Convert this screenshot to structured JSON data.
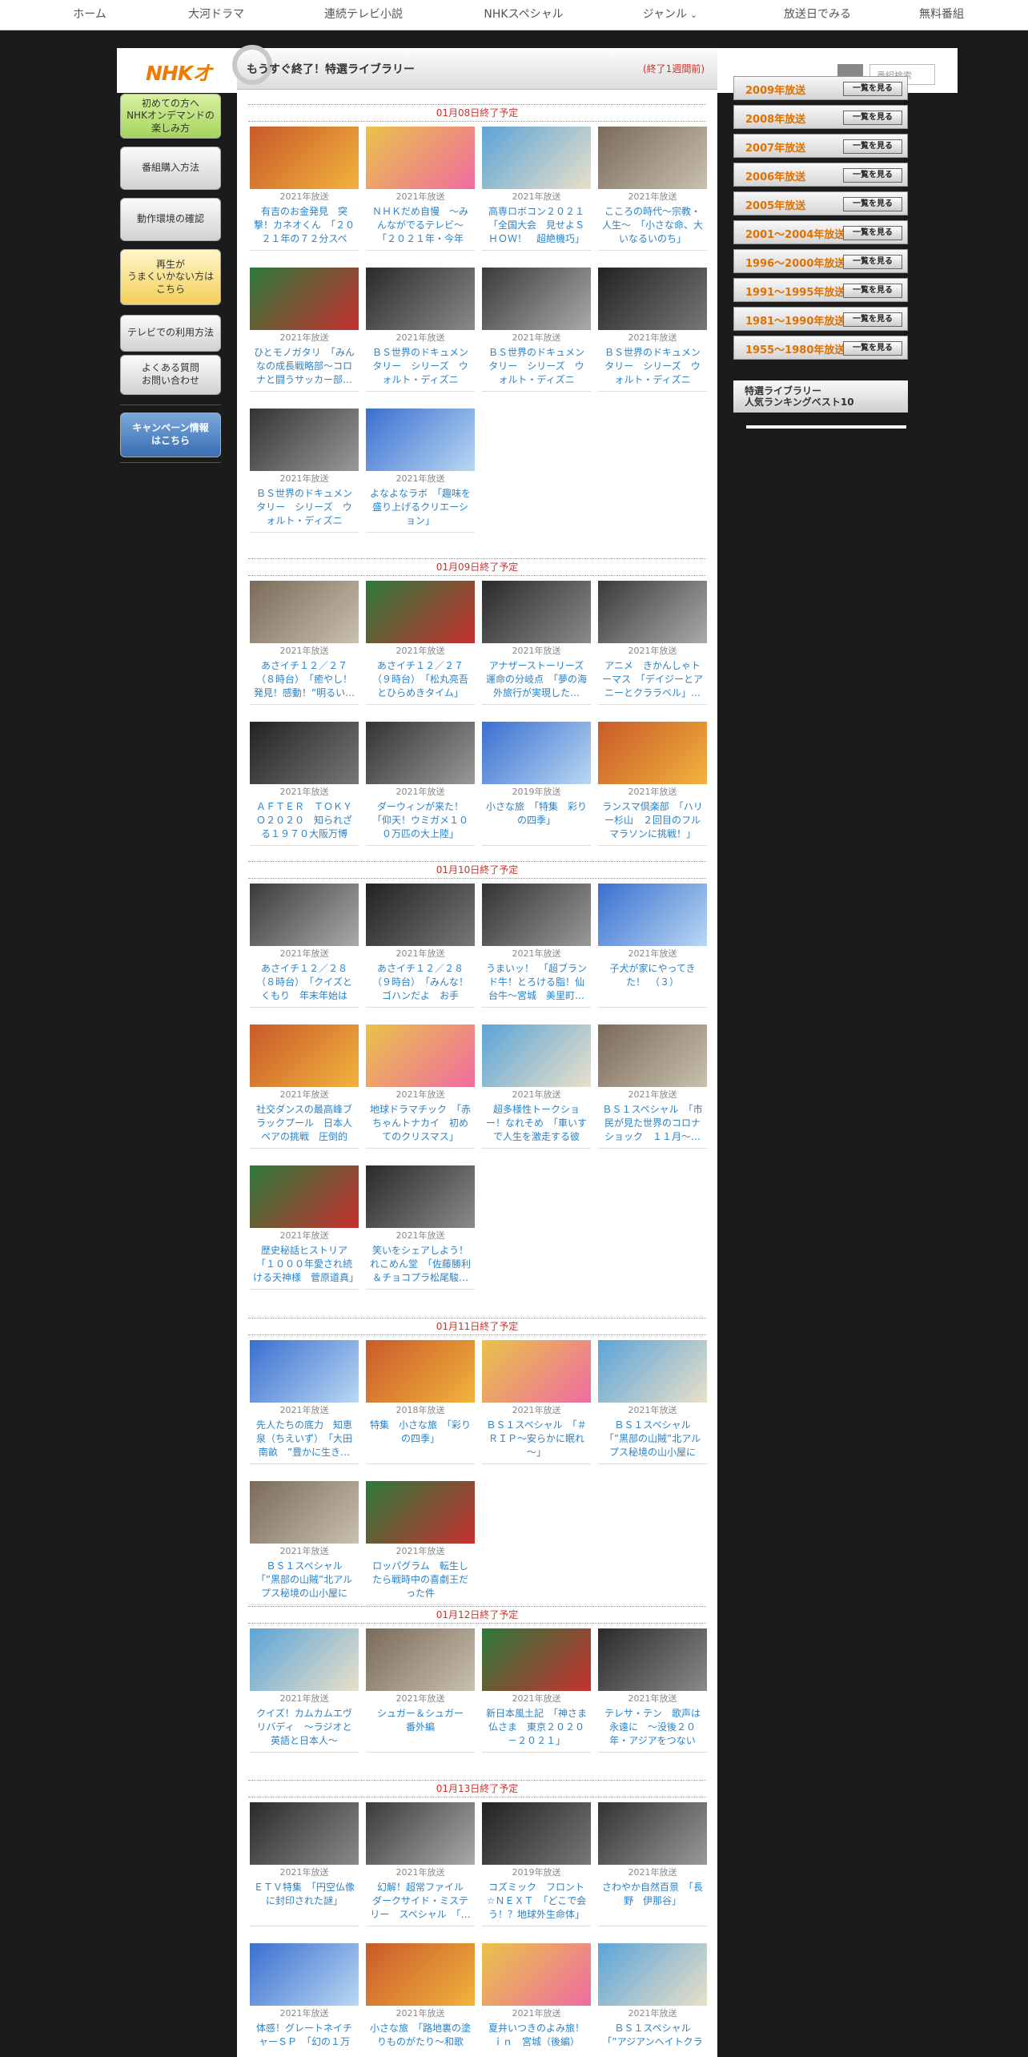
{
  "nav": {
    "items": [
      "ホーム",
      "大河ドラマ",
      "連続テレビ小説",
      "NHKスペシャル",
      "ジャンル",
      "放送日でみる",
      "無料番組"
    ]
  },
  "header": {
    "logo": "NHKオ",
    "search_placeholder": "番組検索"
  },
  "left_sidebar": {
    "first_time": "初めての方へ\nNHKオンデマンドの\n楽しみ方",
    "purchase": "番組購入方法",
    "environment": "動作環境の確認",
    "playback": "再生が\nうまくいかない方は\nこちら",
    "tv_usage": "テレビでの利用方法",
    "faq": "よくある質問\nお問い合わせ",
    "campaign": "キャンペーン情報\nはこちら"
  },
  "banner": {
    "title": "もうすぐ終了！特選ライブラリー",
    "note": "(終了1週間前)"
  },
  "sections": [
    {
      "date": "01月08日終了予定",
      "cards": [
        {
          "year": "2021年放送",
          "title": "有吉のお金発見　突撃！カネオくん　「２０２１年の７２分スペシ…"
        },
        {
          "year": "2021年放送",
          "title": "ＮＨＫだめ自慢　～みんながでるテレビ～　「２０２１年・今年の…"
        },
        {
          "year": "2021年放送",
          "title": "高専ロボコン２０２１　「全国大会　見せよＳＨＯＷ！　超絶機巧」"
        },
        {
          "year": "2021年放送",
          "title": "こころの時代～宗教・人生～　「小さな命、大いなるいのち」"
        },
        {
          "year": "2021年放送",
          "title": "ひとモノガタリ　「みんなの成長戦略部～コロナと闘うサッカー部…"
        },
        {
          "year": "2021年放送",
          "title": "ＢＳ世界のドキュメンタリー　シリーズ　ウォルト・ディズニー　…"
        },
        {
          "year": "2021年放送",
          "title": "ＢＳ世界のドキュメンタリー　シリーズ　ウォルト・ディズニー　…"
        },
        {
          "year": "2021年放送",
          "title": "ＢＳ世界のドキュメンタリー　シリーズ　ウォルト・ディズニー　…"
        },
        {
          "year": "2021年放送",
          "title": "ＢＳ世界のドキュメンタリー　シリーズ　ウォルト・ディズニー　…"
        },
        {
          "year": "2021年放送",
          "title": "よなよなラボ　「趣味を盛り上げるクリエーション」"
        }
      ]
    },
    {
      "date": "01月09日終了予定",
      "cards": [
        {
          "year": "2021年放送",
          "title": "あさイチ１２／２７（８時台）　「癒やし！発見！感動！”明るい…"
        },
        {
          "year": "2021年放送",
          "title": "あさイチ１２／２７（９時台）　「松丸亮吾とひらめきタイム」"
        },
        {
          "year": "2021年放送",
          "title": "アナザーストーリーズ　運命の分岐点　「夢の海外旅行が実現した…"
        },
        {
          "year": "2021年放送",
          "title": "アニメ　きかんしゃトーマス　「デイジーとアニーとクララベル」…"
        },
        {
          "year": "2021年放送",
          "title": "ＡＦＴＥＲ　ＴＯＫＹＯ２０２０　知られざる１９７０大阪万博"
        },
        {
          "year": "2021年放送",
          "title": "ダーウィンが来た！「仰天！ウミガメ１００万匹の大上陸」"
        },
        {
          "year": "2019年放送",
          "title": "小さな旅　「特集　彩りの四季」"
        },
        {
          "year": "2021年放送",
          "title": "ランスマ倶楽部　「ハリー杉山　２回目のフルマラソンに挑戦！」"
        }
      ]
    },
    {
      "date": "01月10日終了予定",
      "cards": [
        {
          "year": "2021年放送",
          "title": "あさイチ１２／２８（８時台）　「クイズとくもり　年末年始は豪…"
        },
        {
          "year": "2021年放送",
          "title": "あさイチ１２／２８（９時台）　「みんな！ゴハンだよ　お手軽！…"
        },
        {
          "year": "2021年放送",
          "title": "うまいッ！　「超ブランド牛！とろける脂！仙台牛～宮城　美里町…"
        },
        {
          "year": "2021年放送",
          "title": "子犬が家にやってきた！　（３）"
        },
        {
          "year": "2021年放送",
          "title": "社交ダンスの最高峰ブラックプール　日本人ペアの挑戦　圧倒的の…"
        },
        {
          "year": "2021年放送",
          "title": "地球ドラマチック　「赤ちゃんトナカイ　初めてのクリスマス」"
        },
        {
          "year": "2021年放送",
          "title": "超多様性トークショー！なれそめ　「車いすで人生を激走する彼と…"
        },
        {
          "year": "2021年放送",
          "title": "ＢＳ１スペシャル　「市民が見た世界のコロナショック　１１月～…"
        },
        {
          "year": "2021年放送",
          "title": "歴史秘話ヒストリア　「１０００年愛され続ける天神様　菅原道真」"
        },
        {
          "year": "2021年放送",
          "title": "笑いをシェアしよう！れこめん堂　「佐藤勝利＆チョコプラ松尾駿…"
        }
      ]
    },
    {
      "date": "01月11日終了予定",
      "cards": [
        {
          "year": "2021年放送",
          "title": "先人たちの底力　知恵泉（ちえいず）　「大田南畝　”豊かに生き…"
        },
        {
          "year": "2018年放送",
          "title": "特集　小さな旅　「彩りの四季」"
        },
        {
          "year": "2021年放送",
          "title": "ＢＳ１スペシャル　「＃ＲＩＰ～安らかに眠れ～」"
        },
        {
          "year": "2021年放送",
          "title": "ＢＳ１スペシャル　「”黒部の山賊”北アルプス秘境の山小屋に生…"
        },
        {
          "year": "2021年放送",
          "title": "ＢＳ１スペシャル　「”黒部の山賊”北アルプス秘境の山小屋に生…"
        },
        {
          "year": "2021年放送",
          "title": "ロッパグラム　転生したら戦時中の喜劇王だった件"
        }
      ]
    },
    {
      "date": "01月12日終了予定",
      "cards": [
        {
          "year": "2021年放送",
          "title": "クイズ！カムカムエヴリバディ　～ラジオと英語と日本人～"
        },
        {
          "year": "2021年放送",
          "title": "シュガー＆シュガー　番外編"
        },
        {
          "year": "2021年放送",
          "title": "新日本風土記　「神さま仏さま　東京２０２０－２０２１」"
        },
        {
          "year": "2021年放送",
          "title": "テレサ・テン　歌声は永遠に　～没後２０年・アジアをつないだ…"
        }
      ]
    },
    {
      "date": "01月13日終了予定",
      "cards": [
        {
          "year": "2021年放送",
          "title": "ＥＴＶ特集　「円空仏像に封印された謎」"
        },
        {
          "year": "2021年放送",
          "title": "幻解！超常ファイル　ダークサイド・ミステリー　スペシャル　「…"
        },
        {
          "year": "2019年放送",
          "title": "コズミック　フロント☆ＮＥＸＴ　「どこで会う！？地球外生命体」"
        },
        {
          "year": "2021年放送",
          "title": "さわやか自然百景　「長野　伊那谷」"
        },
        {
          "year": "2021年放送",
          "title": "体感！グレートネイチャーＳＰ　「幻の１万"
        },
        {
          "year": "2021年放送",
          "title": "小さな旅　「路地裏の塗りものがたり～和歌"
        },
        {
          "year": "2021年放送",
          "title": "夏井いつきのよみ旅！ｉｎ　宮城（後編）"
        },
        {
          "year": "2021年放送",
          "title": "ＢＳ１スペシャル　「”アジアンヘイトクラ"
        }
      ]
    }
  ],
  "right_sidebar": {
    "years": [
      "2009年放送",
      "2008年放送",
      "2007年放送",
      "2006年放送",
      "2005年放送",
      "2001～2004年放送",
      "1996～2000年放送",
      "1991～1995年放送",
      "1981～1990年放送",
      "1955～1980年放送"
    ],
    "view_label": "一覧を見る",
    "ranking": "特選ライブラリー\n人気ランキングベスト10"
  },
  "colors": {
    "accent_red": "#d0302a",
    "link_blue": "#2b82c8",
    "year_orange": "#e07000"
  }
}
